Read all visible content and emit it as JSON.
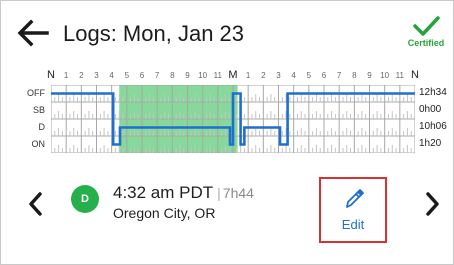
{
  "header": {
    "title": "Logs: Mon, Jan 23",
    "back_icon": "arrow-left-icon",
    "certified_label": "Certified",
    "certified_icon": "checkmark-icon",
    "certified_color": "#25a33c"
  },
  "chart_data": {
    "type": "line",
    "hour_labels": [
      "N",
      "1",
      "2",
      "3",
      "4",
      "5",
      "6",
      "7",
      "8",
      "9",
      "10",
      "11",
      "M",
      "1",
      "2",
      "3",
      "4",
      "5",
      "6",
      "7",
      "8",
      "9",
      "10",
      "11",
      "N"
    ],
    "statuses": [
      "OFF",
      "SB",
      "D",
      "ON"
    ],
    "totals": [
      "12h34",
      "0h00",
      "10h06",
      "1h20"
    ],
    "segments": [
      {
        "status": "OFF",
        "start": 0,
        "end": 4.1
      },
      {
        "status": "ON",
        "start": 4.1,
        "end": 4.55
      },
      {
        "status": "D",
        "start": 4.55,
        "end": 11.8
      },
      {
        "status": "ON",
        "start": 11.8,
        "end": 12.0
      },
      {
        "status": "OFF",
        "start": 12.0,
        "end": 12.5
      },
      {
        "status": "ON",
        "start": 12.5,
        "end": 12.75
      },
      {
        "status": "D",
        "start": 12.75,
        "end": 15.1
      },
      {
        "status": "ON",
        "start": 15.1,
        "end": 15.6
      },
      {
        "status": "OFF",
        "start": 15.6,
        "end": 24
      }
    ],
    "highlight": {
      "start": 4.5,
      "end": 12.3
    },
    "line_color": "#1f6fd1",
    "highlight_color": "#86d99a"
  },
  "event": {
    "avatar_letter": "D",
    "avatar_color": "#26b04c",
    "time": "4:32 am PDT",
    "separator": "|",
    "duration": "7h44",
    "location": "Oregon City, OR"
  },
  "edit": {
    "label": "Edit",
    "icon": "pencil-icon",
    "accent": "#1f6fd1",
    "highlight_border": "#d93131"
  },
  "nav": {
    "prev_icon": "chevron-left-icon",
    "next_icon": "chevron-right-icon"
  }
}
